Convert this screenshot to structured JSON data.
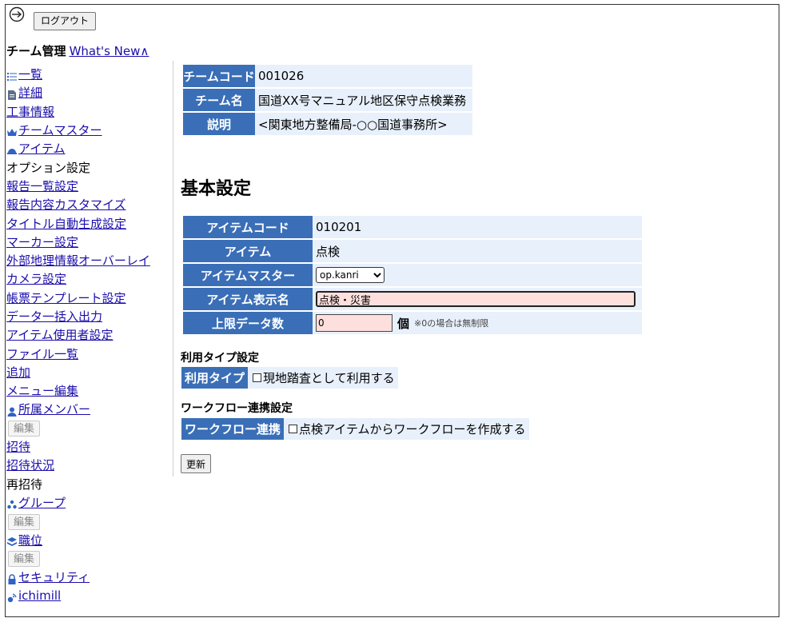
{
  "header": {
    "logout_label": "ログアウト",
    "team_mgmt_title": "チーム管理",
    "whats_new_link": "What's New∧"
  },
  "sidebar": {
    "items": [
      {
        "label": "一覧",
        "link": true,
        "icon": "list-icon"
      },
      {
        "label": "詳細",
        "link": true,
        "icon": "document-icon"
      },
      {
        "label": "工事情報",
        "link": true,
        "icon": ""
      },
      {
        "label": "チームマスター",
        "link": true,
        "icon": "crown-icon"
      },
      {
        "label": "アイテム",
        "link": true,
        "icon": "helmet-icon"
      },
      {
        "label": "オプション設定",
        "link": false,
        "icon": ""
      },
      {
        "label": "報告一覧設定",
        "link": true,
        "icon": ""
      },
      {
        "label": "報告内容カスタマイズ",
        "link": true,
        "icon": ""
      },
      {
        "label": "タイトル自動生成設定",
        "link": true,
        "icon": ""
      },
      {
        "label": "マーカー設定",
        "link": true,
        "icon": ""
      },
      {
        "label": "外部地理情報オーバーレイ",
        "link": true,
        "icon": ""
      },
      {
        "label": "カメラ設定",
        "link": true,
        "icon": ""
      },
      {
        "label": "帳票テンプレート設定",
        "link": true,
        "icon": ""
      },
      {
        "label": "データ一括入出力",
        "link": true,
        "icon": ""
      },
      {
        "label": "アイテム使用者設定",
        "link": true,
        "icon": ""
      },
      {
        "label": "ファイル一覧",
        "link": true,
        "icon": ""
      },
      {
        "label": "追加",
        "link": true,
        "icon": ""
      },
      {
        "label": "メニュー編集",
        "link": true,
        "icon": ""
      },
      {
        "label": "所属メンバー",
        "link": true,
        "icon": "person-icon"
      },
      {
        "label": "編集",
        "button": true
      },
      {
        "label": "招待",
        "link": true,
        "icon": ""
      },
      {
        "label": "招待状況",
        "link": true,
        "icon": ""
      },
      {
        "label": "再招待",
        "link": false,
        "icon": ""
      },
      {
        "label": "グループ",
        "link": true,
        "icon": "group-icon"
      },
      {
        "label": "編集",
        "button": true
      },
      {
        "label": "職位",
        "link": true,
        "icon": "layers-icon"
      },
      {
        "label": "編集",
        "button": true
      },
      {
        "label": "セキュリティ",
        "link": true,
        "icon": "lock-icon"
      },
      {
        "label": "ichimill",
        "link": true,
        "icon": "satellite-icon"
      }
    ]
  },
  "team_info": {
    "code_label": "チームコード",
    "code_value": "001026",
    "name_label": "チーム名",
    "name_value": "国道XX号マニュアル地区保守点検業務",
    "desc_label": "説明",
    "desc_value": "<関東地方整備局-○○国道事務所>"
  },
  "basic_settings": {
    "title": "基本設定",
    "item_code_label": "アイテムコード",
    "item_code_value": "010201",
    "item_label": "アイテム",
    "item_value": "点検",
    "item_master_label": "アイテムマスター",
    "item_master_selected": "op.kanri",
    "display_name_label": "アイテム表示名",
    "display_name_value": "点検・災害",
    "limit_label": "上限データ数",
    "limit_value": "0",
    "limit_unit": "個",
    "limit_note": "※0の場合は無制限"
  },
  "usage_type": {
    "section_title": "利用タイプ設定",
    "label": "利用タイプ",
    "checkbox_label": "現地踏査として利用する"
  },
  "workflow": {
    "section_title": "ワークフロー連携設定",
    "label": "ワークフロー連携",
    "checkbox_label": "点検アイテムからワークフローを作成する"
  },
  "update_label": "更新",
  "colors": {
    "header_blue": "#3a6fb7",
    "value_bg": "#e8f0fb",
    "input_pink": "#fde0de",
    "link": "#1a0dab"
  }
}
